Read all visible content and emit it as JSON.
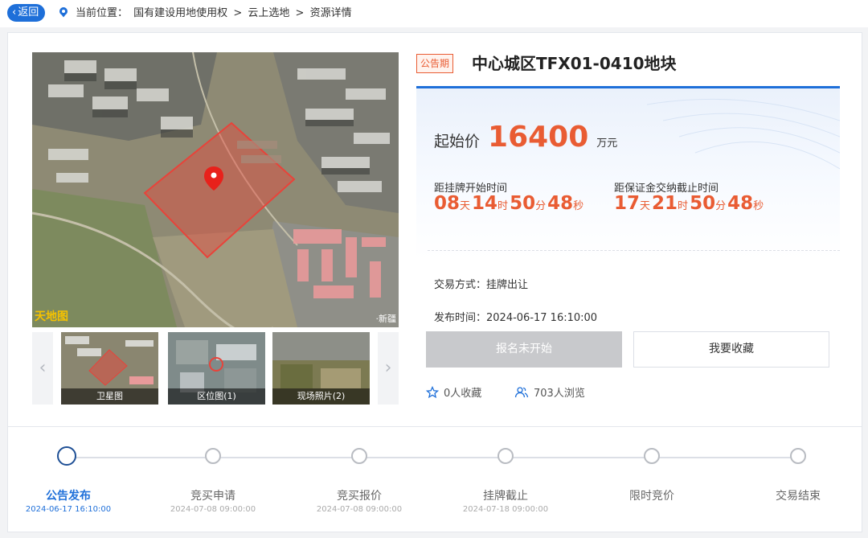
{
  "topbar": {
    "back_label": "返回",
    "breadcrumb": [
      "当前位置：",
      "国有建设用地使用权",
      ">",
      "云上选地",
      ">",
      "资源详情"
    ]
  },
  "map": {
    "watermark_left": "天地图",
    "watermark_right": "·新疆"
  },
  "thumbnails": [
    {
      "label": "卫星图"
    },
    {
      "label": "区位图(1)"
    },
    {
      "label": "现场照片(2)"
    }
  ],
  "listing": {
    "status_tag": "公告期",
    "title": "中心城区TFX01-0410地块",
    "price_label": "起始价",
    "price_value": "16400",
    "price_unit": "万元",
    "countdown1": {
      "label": "距挂牌开始时间",
      "parts": [
        {
          "n": "08",
          "u": "天"
        },
        {
          "n": "14",
          "u": "时"
        },
        {
          "n": "50",
          "u": "分"
        },
        {
          "n": "48",
          "u": "秒"
        }
      ]
    },
    "countdown2": {
      "label": "距保证金交纳截止时间",
      "parts": [
        {
          "n": "17",
          "u": "天"
        },
        {
          "n": "21",
          "u": "时"
        },
        {
          "n": "50",
          "u": "分"
        },
        {
          "n": "48",
          "u": "秒"
        }
      ]
    },
    "trade_method": "交易方式：挂牌出让",
    "publish_time": "发布时间：2024-06-17 16:10:00",
    "signup_button": "报名未开始",
    "favorite_button": "我要收藏",
    "favorites": "0人收藏",
    "views": "703人浏览"
  },
  "colors": {
    "primary": "#1e6fd9",
    "accent": "#e95c33",
    "disabled": "#c8c9cc"
  },
  "steps": [
    {
      "name": "公告发布",
      "date": "2024-06-17 16:10:00",
      "active": true
    },
    {
      "name": "竞买申请",
      "date": "2024-07-08 09:00:00",
      "active": false
    },
    {
      "name": "竞买报价",
      "date": "2024-07-08 09:00:00",
      "active": false
    },
    {
      "name": "挂牌截止",
      "date": "2024-07-18 09:00:00",
      "active": false
    },
    {
      "name": "限时竞价",
      "date": "",
      "active": false
    },
    {
      "name": "交易结束",
      "date": "",
      "active": false
    }
  ]
}
